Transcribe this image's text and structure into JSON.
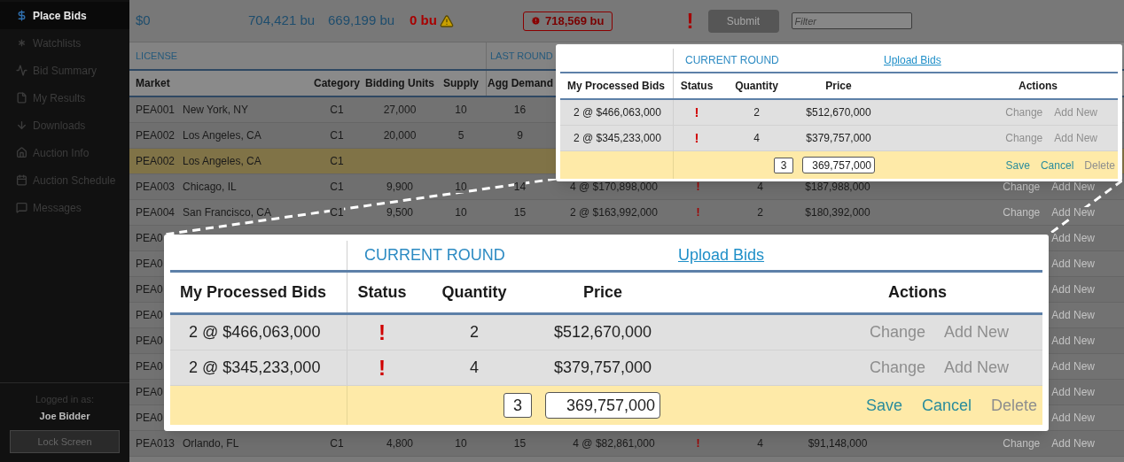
{
  "sidebar": {
    "items": [
      {
        "label": "Place Bids",
        "selected": true
      },
      {
        "label": "Watchlists",
        "selected": false
      },
      {
        "label": "Bid Summary",
        "selected": false
      },
      {
        "label": "My Results",
        "selected": false
      },
      {
        "label": "Downloads",
        "selected": false
      },
      {
        "label": "Auction Info",
        "selected": false
      },
      {
        "label": "Auction Schedule",
        "selected": false
      },
      {
        "label": "Messages",
        "selected": false
      }
    ],
    "footer": {
      "logged_in_label": "Logged in as:",
      "user": "Joe Bidder",
      "lock_button": "Lock Screen"
    }
  },
  "summary": {
    "requested_commitment": "$0",
    "eligibility": "704,421 bu",
    "required_activity": "669,199 bu",
    "submitted_activity": "0 bu",
    "submitted_warning": true,
    "shortfall": "718,569 bu",
    "alert": "!",
    "submit_button": "Submit",
    "filter": {
      "placeholder": "Filter"
    }
  },
  "table": {
    "group_headers": [
      "LICENSE",
      "LAST ROUND"
    ],
    "columns": [
      "Market",
      "Category",
      "Bidding Units",
      "Supply",
      "Agg Demand"
    ],
    "rows": [
      {
        "highlighted": false,
        "market": "PEA001",
        "name": "New York, NY",
        "category": "C1",
        "bidding_units": "27,000",
        "supply": "10",
        "agg_demand": "16"
      },
      {
        "highlighted": false,
        "market": "PEA002",
        "name": "Los Angeles, CA",
        "category": "C1",
        "bidding_units": "20,000",
        "supply": "5",
        "agg_demand": "9"
      },
      {
        "highlighted": true,
        "market": "PEA002",
        "name": "Los Angeles, CA",
        "category": "C1"
      },
      {
        "highlighted": false,
        "market": "PEA003",
        "name": "Chicago, IL",
        "category": "C1",
        "bidding_units": "9,900",
        "supply": "10",
        "agg_demand": "14",
        "processed_bids": "4 @ $170,898,000",
        "status": "!",
        "quantity": "4",
        "price": "$187,988,000",
        "actions": [
          {
            "label": "Change",
            "disabled": true
          },
          {
            "label": "Add New",
            "disabled": true
          }
        ]
      },
      {
        "highlighted": false,
        "market": "PEA004",
        "name": "San Francisco, CA",
        "category": "C1",
        "bidding_units": "9,500",
        "supply": "10",
        "agg_demand": "15",
        "processed_bids": "2 @ $163,992,000",
        "status": "!",
        "quantity": "2",
        "price": "$180,392,000",
        "actions": [
          {
            "label": "Change",
            "disabled": true
          },
          {
            "label": "Add New",
            "disabled": true
          }
        ]
      },
      {
        "highlighted": false,
        "market": "PEA0",
        "actions": [
          {
            "label": "Add New",
            "disabled": true
          }
        ]
      },
      {
        "highlighted": false,
        "market": "PEA0",
        "actions": [
          {
            "label": "Add New",
            "disabled": true
          }
        ]
      },
      {
        "highlighted": false,
        "market": "PEA0",
        "actions": [
          {
            "label": "Add New",
            "disabled": true
          }
        ]
      },
      {
        "highlighted": false,
        "market": "PEA0",
        "actions": [
          {
            "label": "Add New",
            "disabled": true
          }
        ]
      },
      {
        "highlighted": false,
        "market": "PEA0",
        "actions": [
          {
            "label": "Add New",
            "disabled": true
          }
        ]
      },
      {
        "highlighted": false,
        "market": "PEA0",
        "actions": [
          {
            "label": "Add New",
            "disabled": true
          }
        ]
      },
      {
        "highlighted": false,
        "market": "PEA0",
        "actions": [
          {
            "label": "Add New",
            "disabled": true
          }
        ]
      },
      {
        "highlighted": false,
        "market": "PEA0",
        "actions": [
          {
            "label": "Add New",
            "disabled": true
          }
        ]
      },
      {
        "highlighted": false,
        "market": "PEA013",
        "name": "Orlando, FL",
        "category": "C1",
        "bidding_units": "4,800",
        "supply": "10",
        "agg_demand": "15",
        "processed_bids": "4 @ $82,861,000",
        "status": "!",
        "quantity": "4",
        "price": "$91,148,000",
        "actions": [
          {
            "label": "Change",
            "disabled": true
          },
          {
            "label": "Add New",
            "disabled": true
          }
        ]
      }
    ]
  },
  "callouts": [
    {
      "section_title": "CURRENT ROUND",
      "link": "Upload Bids",
      "columns": [
        "My Processed Bids",
        "Status",
        "Quantity",
        "Price",
        "Actions"
      ],
      "rows": [
        {
          "kind": "bid",
          "processed_bids": "2 @ $466,063,000",
          "status": "!",
          "quantity": "2",
          "price": "$512,670,000",
          "actions": [
            {
              "label": "Change",
              "disabled": true
            },
            {
              "label": "Add New",
              "disabled": true
            }
          ]
        },
        {
          "kind": "bid",
          "processed_bids": "2 @ $345,233,000",
          "status": "!",
          "quantity": "4",
          "price": "$379,757,000",
          "actions": [
            {
              "label": "Change",
              "disabled": true
            },
            {
              "label": "Add New",
              "disabled": true
            }
          ]
        },
        {
          "kind": "edit",
          "quantity": "3",
          "price": "369,757,000",
          "actions": [
            {
              "label": "Save",
              "disabled": false
            },
            {
              "label": "Cancel",
              "disabled": false
            },
            {
              "label": "Delete",
              "disabled": true
            }
          ]
        }
      ]
    },
    {
      "section_title": "CURRENT ROUND",
      "link": "Upload Bids",
      "columns": [
        "My Processed Bids",
        "Status",
        "Quantity",
        "Price",
        "Actions"
      ],
      "rows": [
        {
          "kind": "bid",
          "processed_bids": "2 @ $466,063,000",
          "status": "!",
          "quantity": "2",
          "price": "$512,670,000",
          "actions": [
            {
              "label": "Change",
              "disabled": true
            },
            {
              "label": "Add New",
              "disabled": true
            }
          ]
        },
        {
          "kind": "bid",
          "processed_bids": "2 @ $345,233,000",
          "status": "!",
          "quantity": "4",
          "price": "$379,757,000",
          "actions": [
            {
              "label": "Change",
              "disabled": true
            },
            {
              "label": "Add New",
              "disabled": true
            }
          ]
        },
        {
          "kind": "edit",
          "quantity": "3",
          "price": "369,757,000",
          "actions": [
            {
              "label": "Save",
              "disabled": false
            },
            {
              "label": "Cancel",
              "disabled": false
            },
            {
              "label": "Delete",
              "disabled": true
            }
          ]
        }
      ]
    }
  ]
}
